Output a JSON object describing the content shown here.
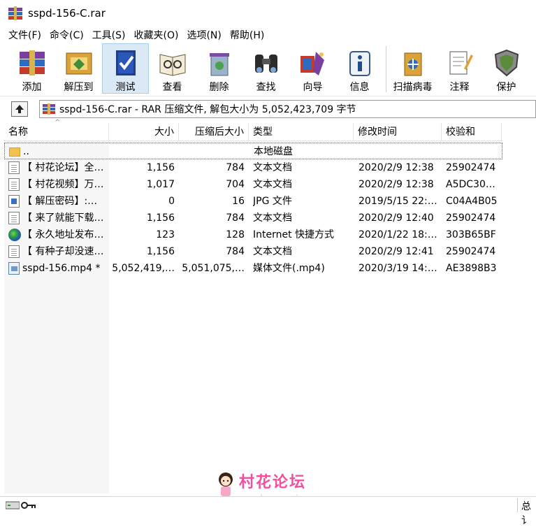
{
  "window": {
    "title": "sspd-156-C.rar"
  },
  "menu": [
    "文件(F)",
    "命令(C)",
    "工具(S)",
    "收藏夹(O)",
    "选项(N)",
    "帮助(H)"
  ],
  "toolbar": [
    {
      "label": "添加",
      "icon": "add-archive-icon"
    },
    {
      "label": "解压到",
      "icon": "extract-to-icon"
    },
    {
      "label": "测试",
      "icon": "test-icon",
      "active": true
    },
    {
      "label": "查看",
      "icon": "view-icon"
    },
    {
      "label": "删除",
      "icon": "delete-icon"
    },
    {
      "label": "查找",
      "icon": "find-icon"
    },
    {
      "label": "向导",
      "icon": "wizard-icon"
    },
    {
      "label": "信息",
      "icon": "info-icon"
    },
    {
      "label": "扫描病毒",
      "icon": "virus-scan-icon"
    },
    {
      "label": "注释",
      "icon": "comment-icon"
    },
    {
      "label": "保护",
      "icon": "protect-icon"
    }
  ],
  "address": {
    "text": "sspd-156-C.rar - RAR 压缩文件, 解包大小为 5,052,423,709 字节"
  },
  "columns": [
    "名称",
    "大小",
    "压缩后大小",
    "类型",
    "修改时间",
    "校验和"
  ],
  "files": [
    {
      "name": "..",
      "size": "",
      "packed": "",
      "type": "本地磁盘",
      "modified": "",
      "crc": "",
      "icon": "folder-icon"
    },
    {
      "name": "【 村花论坛】全…",
      "size": "1,156",
      "packed": "784",
      "type": "文本文档",
      "modified": "2020/2/9 12:38",
      "crc": "25902474",
      "icon": "text-document-icon"
    },
    {
      "name": "【 村花视频】万…",
      "size": "1,017",
      "packed": "704",
      "type": "文本文档",
      "modified": "2020/2/9 12:38",
      "crc": "A5DC30…",
      "icon": "text-document-icon"
    },
    {
      "name": "【 解压密码】:…",
      "size": "0",
      "packed": "16",
      "type": "JPG 文件",
      "modified": "2019/5/15 22:…",
      "crc": "C04A4B05",
      "icon": "jpg-file-icon"
    },
    {
      "name": "【 来了就能下载…",
      "size": "1,156",
      "packed": "784",
      "type": "文本文档",
      "modified": "2020/2/9 12:40",
      "crc": "25902474",
      "icon": "text-document-icon"
    },
    {
      "name": "【 永久地址发布…",
      "size": "123",
      "packed": "128",
      "type": "Internet 快捷方式",
      "modified": "2020/1/22 18:…",
      "crc": "303B65BF",
      "icon": "internet-shortcut-icon"
    },
    {
      "name": "【 有种子却没速…",
      "size": "1,156",
      "packed": "784",
      "type": "文本文档",
      "modified": "2020/2/9 12:41",
      "crc": "25902474",
      "icon": "text-document-icon"
    },
    {
      "name": "sspd-156.mp4 *",
      "size": "5,052,419,…",
      "packed": "5,051,075,…",
      "type": "媒体文件(.mp4)",
      "modified": "2020/3/19 14:…",
      "crc": "AE3898B3",
      "icon": "media-file-icon"
    }
  ],
  "watermark": {
    "title": "村花论坛",
    "subtitle": "cunhua.win"
  },
  "status": {
    "text": "总讠"
  }
}
